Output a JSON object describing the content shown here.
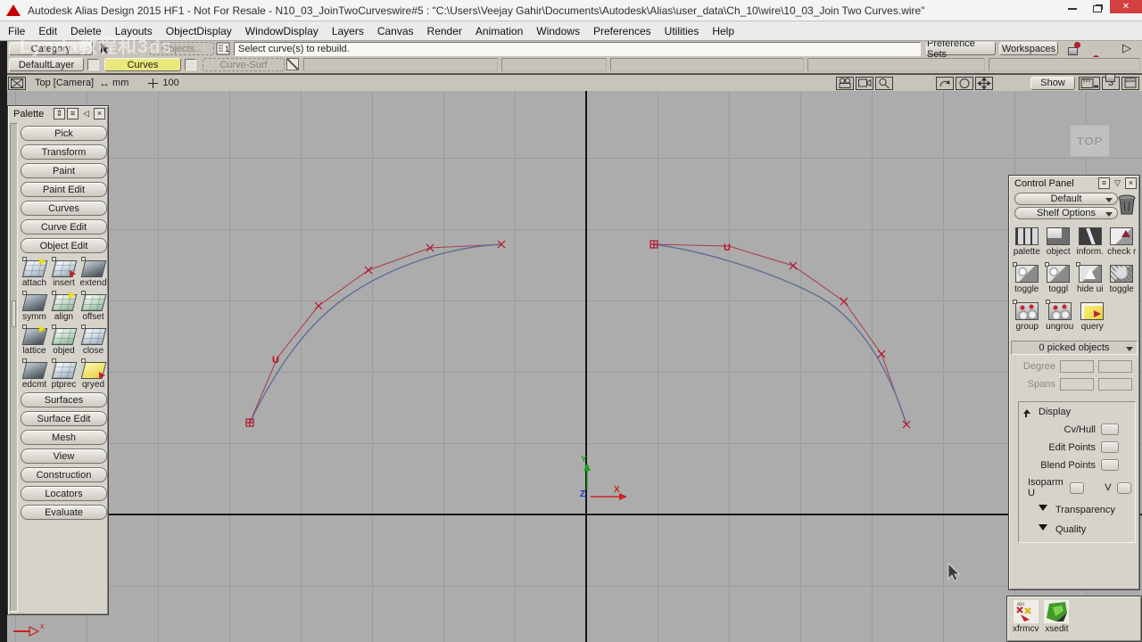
{
  "titlebar": {
    "title": "Autodesk Alias Design 2015 HF1 - Not For Resale  - N10_03_JoinTwoCurveswire#5 : \"C:\\Users\\Veejay Gahir\\Documents\\Autodesk\\Alias\\user_data\\Ch_10\\wire\\10_03_Join Two Curves.wire\""
  },
  "menubar": {
    "items": [
      "File",
      "Edit",
      "Delete",
      "Layouts",
      "ObjectDisplay",
      "WindowDisplay",
      "Layers",
      "Canvas",
      "Render",
      "Animation",
      "Windows",
      "Preferences",
      "Utilities",
      "Help"
    ]
  },
  "watermark": "Lynda教程和3ds",
  "toolbar": {
    "category": "Category",
    "objects": "Objects...",
    "prompt": "Select curve(s) to rebuild.",
    "preference_sets": "Preference Sets",
    "workspaces": "Workspaces"
  },
  "layerbar": {
    "default_layer": "DefaultLayer",
    "active_layer": "Curves",
    "ghost_layer": "Curve-Surf"
  },
  "viewport": {
    "camera": "Top [Camera]",
    "units": "mm",
    "zoom_value": "100",
    "show": "Show",
    "pane_count": "3",
    "view_badge": "TOP",
    "axis": {
      "x": "X",
      "y": "Y",
      "z": "Z"
    },
    "cv_direction_label": "U"
  },
  "palette": {
    "title": "Palette",
    "tabs_top": [
      "Pick",
      "Transform",
      "Paint",
      "Paint Edit",
      "Curves",
      "Curve Edit",
      "Object Edit"
    ],
    "object_edit_tools": [
      "attach",
      "insert",
      "extend",
      "symm",
      "align",
      "offset",
      "lattice",
      "objed",
      "close",
      "edcmt",
      "ptprec",
      "qryed"
    ],
    "tabs_bottom": [
      "Surfaces",
      "Surface Edit",
      "Mesh",
      "View",
      "Construction",
      "Locators",
      "Evaluate"
    ]
  },
  "control_panel": {
    "title": "Control Panel",
    "preset_dropdown": "Default",
    "shelf_dropdown": "Shelf Options",
    "shelf_row1": [
      "palette",
      "object",
      "inform.",
      "check r"
    ],
    "shelf_row2": [
      "toggle",
      "toggl",
      "hide ui",
      "toggle"
    ],
    "shelf_row3": [
      "group",
      "ungrou",
      "query"
    ],
    "picked_status": "0 picked objects",
    "degree_label": "Degree",
    "spans_label": "Spans",
    "display_section": {
      "title": "Display",
      "cv_hull": "Cv/Hull",
      "edit_points": "Edit Points",
      "blend_points": "Blend Points",
      "isoparm_u": "Isoparm U",
      "isoparm_v": "V",
      "transparency": "Transparency",
      "quality": "Quality"
    }
  },
  "bottom_shelf": {
    "tools": [
      "xfrmcv",
      "xsedit"
    ]
  },
  "colors": {
    "active_layer_yellow": "#e9e87c",
    "curve_blue": "#5f6e96",
    "hull_red": "#a93a4a",
    "marker_red": "#b5122b",
    "axis_x_red": "#cc2222",
    "axis_y_green": "#22aa22",
    "axis_z_blue": "#2233cc"
  }
}
